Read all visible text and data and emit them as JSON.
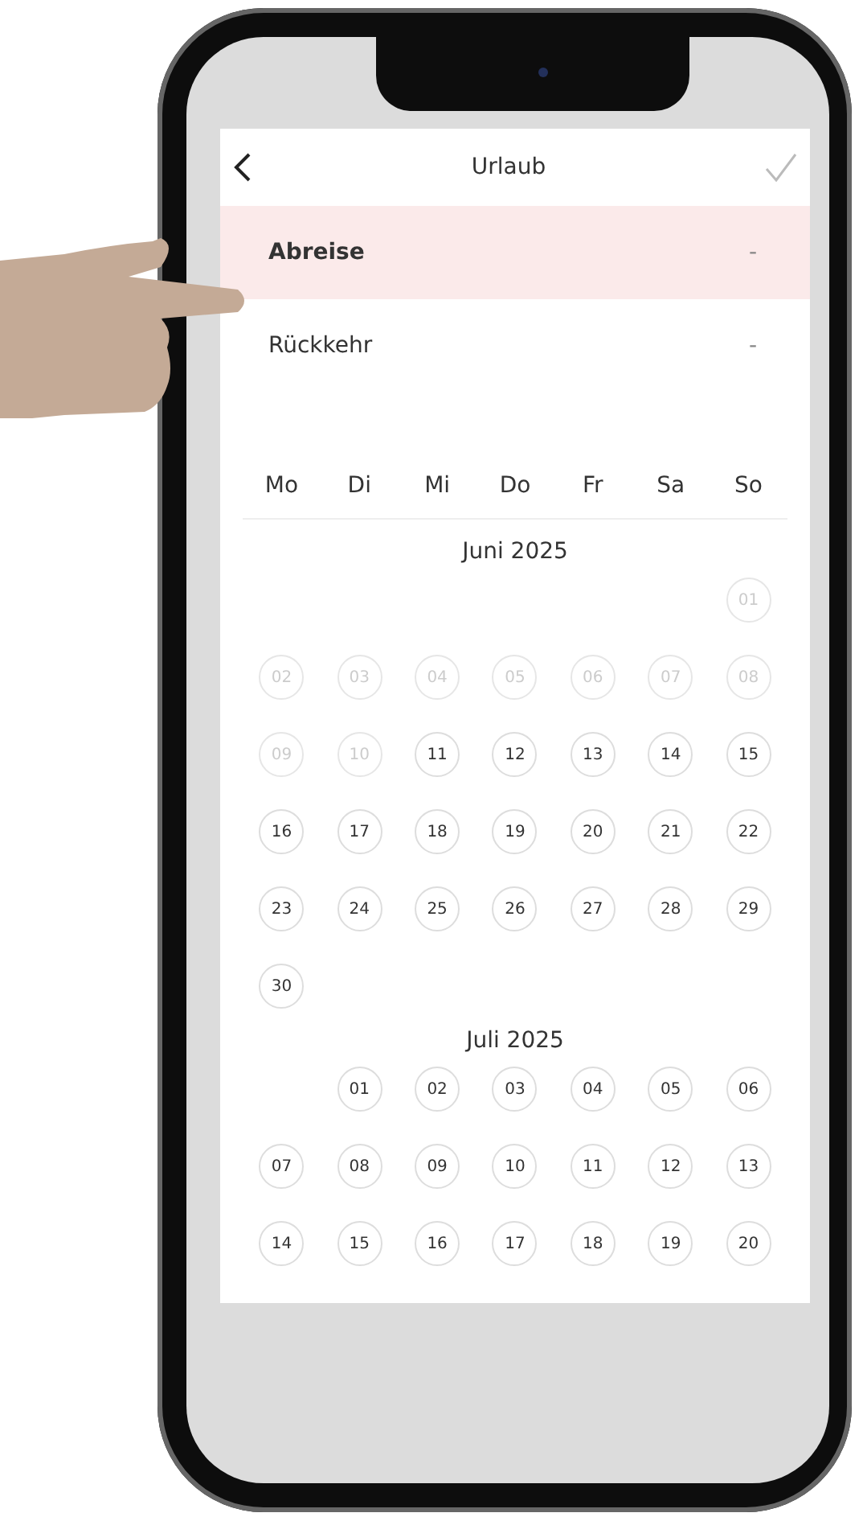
{
  "header": {
    "title": "Urlaub"
  },
  "fields": [
    {
      "label": "Abreise",
      "value": "-",
      "selected": true
    },
    {
      "label": "Rückkehr",
      "value": "-",
      "selected": false
    }
  ],
  "weekdays": [
    "Mo",
    "Di",
    "Mi",
    "Do",
    "Fr",
    "Sa",
    "So"
  ],
  "months": [
    {
      "title": "Juni 2025",
      "weeks": [
        [
          {
            "label": "01",
            "disabled": true
          }
        ],
        [
          {
            "label": "02",
            "disabled": true
          },
          {
            "label": "03",
            "disabled": true
          },
          {
            "label": "04",
            "disabled": true
          },
          {
            "label": "05",
            "disabled": true
          },
          {
            "label": "06",
            "disabled": true
          },
          {
            "label": "07",
            "disabled": true
          },
          {
            "label": "08",
            "disabled": true
          }
        ],
        [
          {
            "label": "09",
            "disabled": true
          },
          {
            "label": "10",
            "disabled": true
          },
          {
            "label": "11",
            "disabled": false
          },
          {
            "label": "12",
            "disabled": false
          },
          {
            "label": "13",
            "disabled": false
          },
          {
            "label": "14",
            "disabled": false
          },
          {
            "label": "15",
            "disabled": false
          }
        ],
        [
          {
            "label": "16",
            "disabled": false
          },
          {
            "label": "17",
            "disabled": false
          },
          {
            "label": "18",
            "disabled": false
          },
          {
            "label": "19",
            "disabled": false
          },
          {
            "label": "20",
            "disabled": false
          },
          {
            "label": "21",
            "disabled": false
          },
          {
            "label": "22",
            "disabled": false
          }
        ],
        [
          {
            "label": "23",
            "disabled": false
          },
          {
            "label": "24",
            "disabled": false
          },
          {
            "label": "25",
            "disabled": false
          },
          {
            "label": "26",
            "disabled": false
          },
          {
            "label": "27",
            "disabled": false
          },
          {
            "label": "28",
            "disabled": false
          },
          {
            "label": "29",
            "disabled": false
          }
        ],
        [
          {
            "label": "30",
            "disabled": false
          }
        ]
      ]
    },
    {
      "title": "Juli 2025",
      "weeks": [
        [
          {
            "label": "01",
            "disabled": false
          },
          {
            "label": "02",
            "disabled": false
          },
          {
            "label": "03",
            "disabled": false
          },
          {
            "label": "04",
            "disabled": false
          },
          {
            "label": "05",
            "disabled": false
          },
          {
            "label": "06",
            "disabled": false
          }
        ],
        [
          {
            "label": "07",
            "disabled": false
          },
          {
            "label": "08",
            "disabled": false
          },
          {
            "label": "09",
            "disabled": false
          },
          {
            "label": "10",
            "disabled": false
          },
          {
            "label": "11",
            "disabled": false
          },
          {
            "label": "12",
            "disabled": false
          },
          {
            "label": "13",
            "disabled": false
          }
        ],
        [
          {
            "label": "14",
            "disabled": false
          },
          {
            "label": "15",
            "disabled": false
          },
          {
            "label": "16",
            "disabled": false
          },
          {
            "label": "17",
            "disabled": false
          },
          {
            "label": "18",
            "disabled": false
          },
          {
            "label": "19",
            "disabled": false
          },
          {
            "label": "20",
            "disabled": false
          }
        ]
      ]
    }
  ]
}
